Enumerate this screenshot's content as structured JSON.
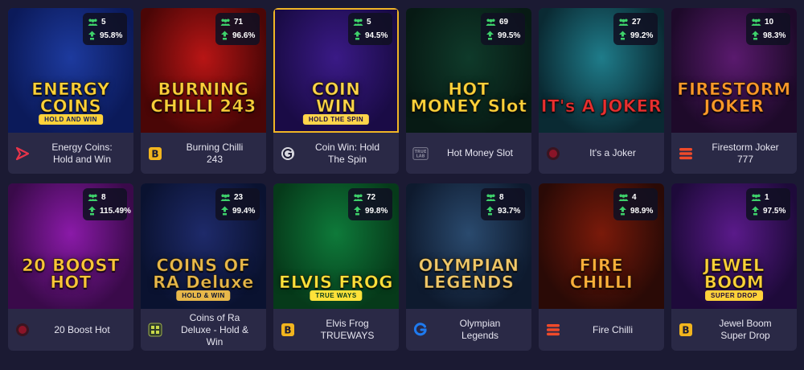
{
  "games": [
    {
      "name": "Energy Coins:\nHold and Win",
      "art_title": "ENERGY\nCOINS",
      "art_sub": "HOLD AND WIN",
      "players": "5",
      "rtp": "95.8%",
      "provider_icon": "play-triangle-icon",
      "colors": [
        "#1d3a9e",
        "#0b1a5a",
        "#ffd23a"
      ]
    },
    {
      "name": "Burning Chilli\n243",
      "art_title": "BURNING\nCHILLI 243",
      "art_sub": "",
      "players": "71",
      "rtp": "96.6%",
      "provider_icon": "b-square-icon",
      "colors": [
        "#b81515",
        "#4a0606",
        "#ffcf3a"
      ]
    },
    {
      "name": "Coin Win: Hold\nThe Spin",
      "art_title": "COIN\nWIN",
      "art_sub": "HOLD THE SPIN",
      "players": "5",
      "rtp": "94.5%",
      "provider_icon": "g-circle-icon",
      "colors": [
        "#3a1a86",
        "#1a0b46",
        "#ffd54a"
      ]
    },
    {
      "name": "Hot Money Slot",
      "art_title": "HOT\nMONEY Slot",
      "art_sub": "",
      "players": "69",
      "rtp": "99.5%",
      "provider_icon": "truelab-icon",
      "colors": [
        "#0f3a2a",
        "#071a14",
        "#ffd23a"
      ]
    },
    {
      "name": "It's a Joker",
      "art_title": "IT's A JOKER",
      "art_sub": "",
      "players": "27",
      "rtp": "99.2%",
      "provider_icon": "red-dot-icon",
      "colors": [
        "#1f7c8a",
        "#0a2a33",
        "#e83030"
      ]
    },
    {
      "name": "Firestorm Joker\n777",
      "art_title": "FIRESTORM\nJOKER",
      "art_sub": "",
      "players": "10",
      "rtp": "98.3%",
      "provider_icon": "stack-bars-icon",
      "colors": [
        "#5a1a6e",
        "#1e0a2a",
        "#ff9a2a"
      ]
    },
    {
      "name": "20 Boost Hot",
      "art_title": "20 BOOST\nHOT",
      "art_sub": "",
      "players": "8",
      "rtp": "115.49%",
      "provider_icon": "red-dot-icon",
      "colors": [
        "#8a1aa8",
        "#3a0a4a",
        "#ffc63a"
      ]
    },
    {
      "name": "Coins of Ra\nDeluxe - Hold &\nWin",
      "art_title": "COINS OF\nRA Deluxe",
      "art_sub": "HOLD & WIN",
      "players": "23",
      "rtp": "99.4%",
      "provider_icon": "box-grid-icon",
      "colors": [
        "#1e2a6a",
        "#0a1230",
        "#e8b84a"
      ]
    },
    {
      "name": "Elvis Frog\nTRUEWAYS",
      "art_title": "ELVIS FROG",
      "art_sub": "TRUE WAYS",
      "players": "72",
      "rtp": "99.8%",
      "provider_icon": "b-square-icon",
      "colors": [
        "#0e7a3a",
        "#063a1a",
        "#ffe23a"
      ]
    },
    {
      "name": "Olympian\nLegends",
      "art_title": "OLYMPIAN\nLEGENDS",
      "art_sub": "",
      "players": "8",
      "rtp": "93.7%",
      "provider_icon": "g-blue-icon",
      "colors": [
        "#2a4a6e",
        "#0e1a2e",
        "#f0c86a"
      ]
    },
    {
      "name": "Fire Chilli",
      "art_title": "FIRE\nCHILLI",
      "art_sub": "",
      "players": "4",
      "rtp": "98.9%",
      "provider_icon": "stack-bars-icon",
      "colors": [
        "#7a1a0a",
        "#2a0a06",
        "#ffb03a"
      ]
    },
    {
      "name": "Jewel Boom\nSuper Drop",
      "art_title": "JEWEL\nBOOM",
      "art_sub": "SUPER DROP",
      "players": "1",
      "rtp": "97.5%",
      "provider_icon": "b-square-icon",
      "colors": [
        "#5a1a8a",
        "#1e0a3a",
        "#ffd23a"
      ]
    }
  ]
}
